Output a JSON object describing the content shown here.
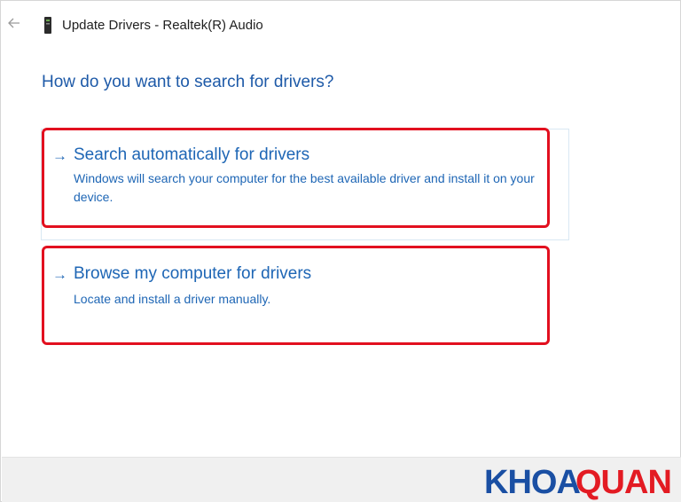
{
  "window": {
    "title": "Update Drivers - Realtek(R) Audio",
    "back_icon": "back-arrow-icon",
    "device_icon": "audio-device-icon"
  },
  "main": {
    "heading": "How do you want to search for drivers?",
    "options": [
      {
        "title": "Search automatically for drivers",
        "description": "Windows will search your computer for the best available driver and install it on your device.",
        "icon": "arrow-right-icon"
      },
      {
        "title": "Browse my computer for drivers",
        "description": "Locate and install a driver manually.",
        "icon": "arrow-right-icon"
      }
    ]
  },
  "watermark": {
    "text": "KHOAQUAN",
    "part1": "KHOA",
    "part2": "QUAN",
    "colors": {
      "part1": "#1a4fa3",
      "part2": "#e31b23"
    }
  },
  "colors": {
    "accent": "#1e66b5",
    "heading": "#1e5aa8",
    "highlight": "#e2101f",
    "footer": "#f0f0f0"
  }
}
